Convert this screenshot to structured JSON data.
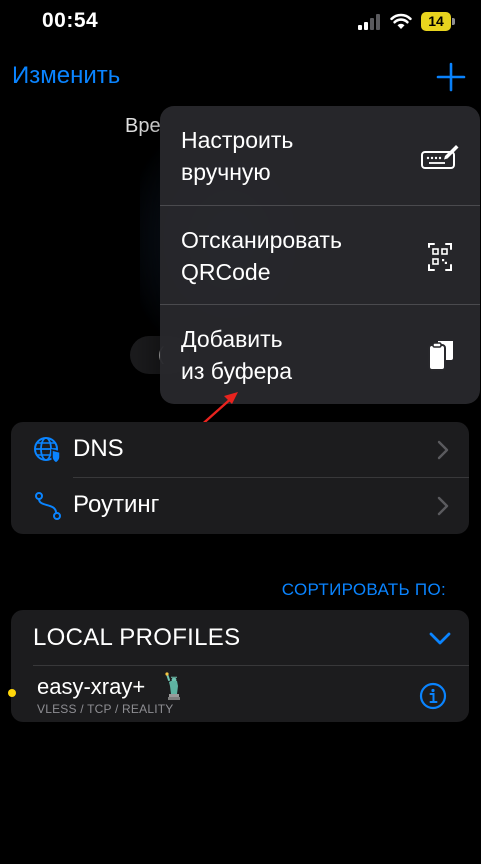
{
  "status_bar": {
    "time": "00:54",
    "battery": "14",
    "battery_color": "#e8d41e"
  },
  "nav": {
    "edit_label": "Изменить",
    "add_icon": "plus-icon",
    "accent_color": "#0a84ff"
  },
  "background_peek": {
    "text": "Вре",
    "pill_text": "("
  },
  "menu": {
    "items": [
      {
        "label": "Настроить\nвручную",
        "icon": "keyboard-pencil-icon"
      },
      {
        "label": "Отсканировать\nQRCode",
        "icon": "qr-scan-icon"
      },
      {
        "label": "Добавить\nиз буфера",
        "icon": "clipboard-icon"
      }
    ]
  },
  "settings": {
    "items": [
      {
        "label": "DNS",
        "icon": "globe-shield-icon"
      },
      {
        "label": "Роутинг",
        "icon": "route-icon"
      }
    ]
  },
  "sort": {
    "label": "СОРТИРОВАТЬ ПО:"
  },
  "profiles": {
    "header": "LOCAL PROFILES",
    "items": [
      {
        "name": "easy-xray+",
        "subtitle": "VLESS / TCP / REALITY",
        "status_color": "#ffd60a"
      }
    ]
  }
}
